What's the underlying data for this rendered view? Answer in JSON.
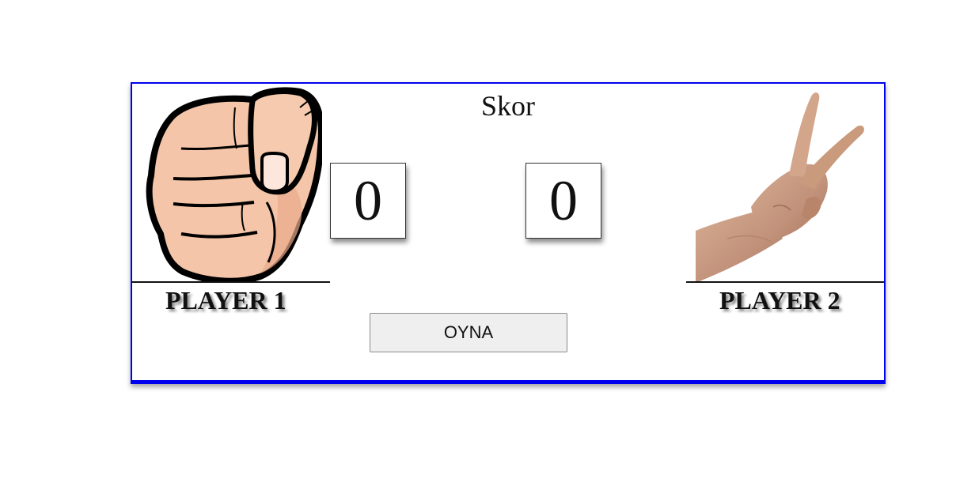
{
  "title": "Skor",
  "players": [
    {
      "label": "PLAYER 1",
      "score": "0",
      "hand": "rock-fist-icon"
    },
    {
      "label": "PLAYER 2",
      "score": "0",
      "hand": "scissors-hand-icon"
    }
  ],
  "play_button": "OYNA",
  "colors": {
    "board_border": "#0000ee",
    "fist_skin": "#f4c5a8",
    "photo_skin": "#c99a7c"
  }
}
